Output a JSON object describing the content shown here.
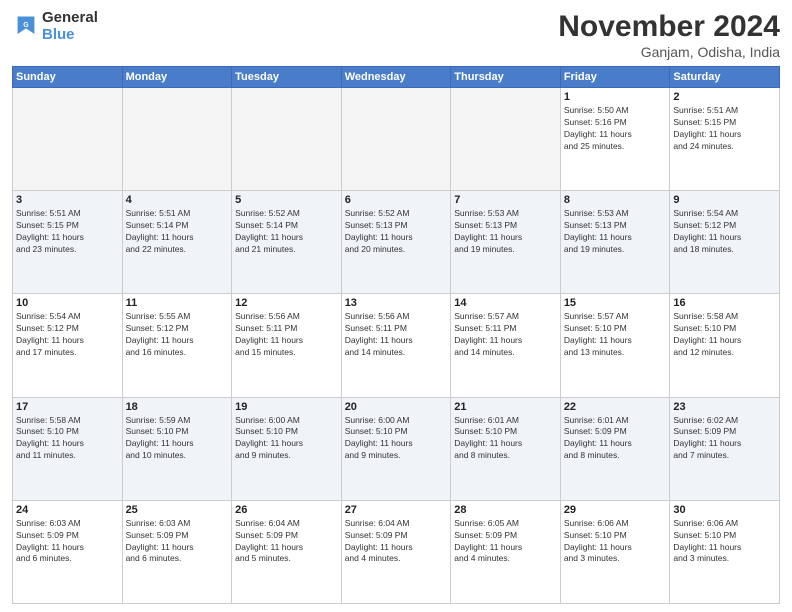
{
  "header": {
    "logo_general": "General",
    "logo_blue": "Blue",
    "month_title": "November 2024",
    "location": "Ganjam, Odisha, India"
  },
  "weekdays": [
    "Sunday",
    "Monday",
    "Tuesday",
    "Wednesday",
    "Thursday",
    "Friday",
    "Saturday"
  ],
  "weeks": [
    [
      {
        "day": "",
        "info": ""
      },
      {
        "day": "",
        "info": ""
      },
      {
        "day": "",
        "info": ""
      },
      {
        "day": "",
        "info": ""
      },
      {
        "day": "",
        "info": ""
      },
      {
        "day": "1",
        "info": "Sunrise: 5:50 AM\nSunset: 5:16 PM\nDaylight: 11 hours\nand 25 minutes."
      },
      {
        "day": "2",
        "info": "Sunrise: 5:51 AM\nSunset: 5:15 PM\nDaylight: 11 hours\nand 24 minutes."
      }
    ],
    [
      {
        "day": "3",
        "info": "Sunrise: 5:51 AM\nSunset: 5:15 PM\nDaylight: 11 hours\nand 23 minutes."
      },
      {
        "day": "4",
        "info": "Sunrise: 5:51 AM\nSunset: 5:14 PM\nDaylight: 11 hours\nand 22 minutes."
      },
      {
        "day": "5",
        "info": "Sunrise: 5:52 AM\nSunset: 5:14 PM\nDaylight: 11 hours\nand 21 minutes."
      },
      {
        "day": "6",
        "info": "Sunrise: 5:52 AM\nSunset: 5:13 PM\nDaylight: 11 hours\nand 20 minutes."
      },
      {
        "day": "7",
        "info": "Sunrise: 5:53 AM\nSunset: 5:13 PM\nDaylight: 11 hours\nand 19 minutes."
      },
      {
        "day": "8",
        "info": "Sunrise: 5:53 AM\nSunset: 5:13 PM\nDaylight: 11 hours\nand 19 minutes."
      },
      {
        "day": "9",
        "info": "Sunrise: 5:54 AM\nSunset: 5:12 PM\nDaylight: 11 hours\nand 18 minutes."
      }
    ],
    [
      {
        "day": "10",
        "info": "Sunrise: 5:54 AM\nSunset: 5:12 PM\nDaylight: 11 hours\nand 17 minutes."
      },
      {
        "day": "11",
        "info": "Sunrise: 5:55 AM\nSunset: 5:12 PM\nDaylight: 11 hours\nand 16 minutes."
      },
      {
        "day": "12",
        "info": "Sunrise: 5:56 AM\nSunset: 5:11 PM\nDaylight: 11 hours\nand 15 minutes."
      },
      {
        "day": "13",
        "info": "Sunrise: 5:56 AM\nSunset: 5:11 PM\nDaylight: 11 hours\nand 14 minutes."
      },
      {
        "day": "14",
        "info": "Sunrise: 5:57 AM\nSunset: 5:11 PM\nDaylight: 11 hours\nand 14 minutes."
      },
      {
        "day": "15",
        "info": "Sunrise: 5:57 AM\nSunset: 5:10 PM\nDaylight: 11 hours\nand 13 minutes."
      },
      {
        "day": "16",
        "info": "Sunrise: 5:58 AM\nSunset: 5:10 PM\nDaylight: 11 hours\nand 12 minutes."
      }
    ],
    [
      {
        "day": "17",
        "info": "Sunrise: 5:58 AM\nSunset: 5:10 PM\nDaylight: 11 hours\nand 11 minutes."
      },
      {
        "day": "18",
        "info": "Sunrise: 5:59 AM\nSunset: 5:10 PM\nDaylight: 11 hours\nand 10 minutes."
      },
      {
        "day": "19",
        "info": "Sunrise: 6:00 AM\nSunset: 5:10 PM\nDaylight: 11 hours\nand 9 minutes."
      },
      {
        "day": "20",
        "info": "Sunrise: 6:00 AM\nSunset: 5:10 PM\nDaylight: 11 hours\nand 9 minutes."
      },
      {
        "day": "21",
        "info": "Sunrise: 6:01 AM\nSunset: 5:10 PM\nDaylight: 11 hours\nand 8 minutes."
      },
      {
        "day": "22",
        "info": "Sunrise: 6:01 AM\nSunset: 5:09 PM\nDaylight: 11 hours\nand 8 minutes."
      },
      {
        "day": "23",
        "info": "Sunrise: 6:02 AM\nSunset: 5:09 PM\nDaylight: 11 hours\nand 7 minutes."
      }
    ],
    [
      {
        "day": "24",
        "info": "Sunrise: 6:03 AM\nSunset: 5:09 PM\nDaylight: 11 hours\nand 6 minutes."
      },
      {
        "day": "25",
        "info": "Sunrise: 6:03 AM\nSunset: 5:09 PM\nDaylight: 11 hours\nand 6 minutes."
      },
      {
        "day": "26",
        "info": "Sunrise: 6:04 AM\nSunset: 5:09 PM\nDaylight: 11 hours\nand 5 minutes."
      },
      {
        "day": "27",
        "info": "Sunrise: 6:04 AM\nSunset: 5:09 PM\nDaylight: 11 hours\nand 4 minutes."
      },
      {
        "day": "28",
        "info": "Sunrise: 6:05 AM\nSunset: 5:09 PM\nDaylight: 11 hours\nand 4 minutes."
      },
      {
        "day": "29",
        "info": "Sunrise: 6:06 AM\nSunset: 5:10 PM\nDaylight: 11 hours\nand 3 minutes."
      },
      {
        "day": "30",
        "info": "Sunrise: 6:06 AM\nSunset: 5:10 PM\nDaylight: 11 hours\nand 3 minutes."
      }
    ]
  ]
}
